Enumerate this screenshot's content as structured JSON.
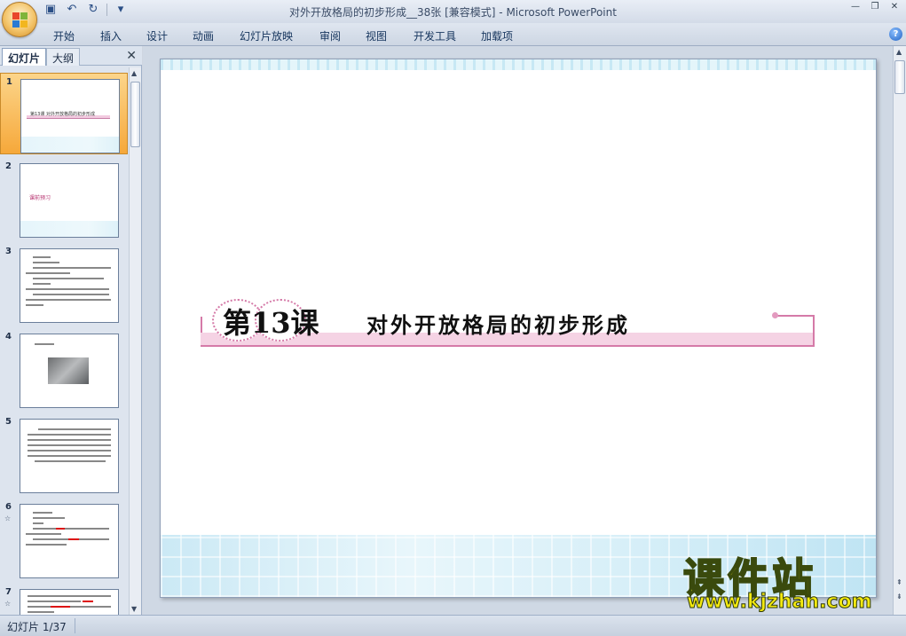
{
  "window": {
    "title": "对外开放格局的初步形成__38张 [兼容模式] - Microsoft PowerPoint",
    "quick_access": [
      "save-icon",
      "undo-icon",
      "redo-icon",
      "customize-icon"
    ],
    "controls": [
      "minimize-icon",
      "restore-icon",
      "close-icon"
    ]
  },
  "menu": {
    "tabs": [
      "开始",
      "插入",
      "设计",
      "动画",
      "幻灯片放映",
      "审阅",
      "视图",
      "开发工具",
      "加载项"
    ]
  },
  "left_panel": {
    "tab_slides": "幻灯片",
    "tab_outline": "大纲",
    "selected_index": 1,
    "thumbnails": [
      {
        "number": "1",
        "animated": false,
        "text": "第13课  对外开放格局的初步形成"
      },
      {
        "number": "2",
        "animated": false,
        "text": "课前预习"
      },
      {
        "number": "3",
        "animated": false,
        "text": ""
      },
      {
        "number": "4",
        "animated": false,
        "text": ""
      },
      {
        "number": "5",
        "animated": false,
        "text": ""
      },
      {
        "number": "6",
        "animated": true,
        "text": ""
      },
      {
        "number": "7",
        "animated": true,
        "text": ""
      }
    ]
  },
  "slide": {
    "lesson_number": "第13课",
    "lesson_title": "对外开放格局的初步形成"
  },
  "status": {
    "slide_counter": "幻灯片 1/37"
  },
  "watermark": {
    "brand": "课件站",
    "url": "www.kjzhan.com"
  },
  "colors": {
    "accent_pink": "#d57aa8",
    "selected_thumb": "#f6a83a",
    "watermark_yellow": "#f3e90f"
  }
}
